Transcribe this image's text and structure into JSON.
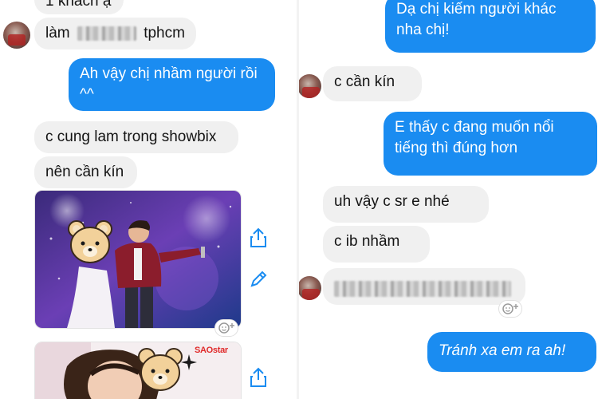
{
  "left": {
    "messages": [
      {
        "text": "1 khách ạ"
      },
      {
        "prefix": "làm",
        "suffix": "tphcm"
      },
      {
        "text_line1": "Ah vậy chị nhầm người rồi",
        "text_line2": "^^"
      },
      {
        "text": "c cung lam trong showbix"
      },
      {
        "text": "nên cần kín"
      }
    ],
    "watermark": "SAOstar"
  },
  "right": {
    "messages": [
      {
        "text_line1": "Dạ chị kiếm người khác",
        "text_line2": "nha chị!"
      },
      {
        "text": "c cần kín"
      },
      {
        "text_line1": "E thấy c đang muốn nổi",
        "text_line2": "tiếng thì đúng hơn"
      },
      {
        "text": "uh vậy c sr e nhé"
      },
      {
        "text": "c ib nhầm"
      },
      {
        "text": "Tránh xa em ra ah!"
      }
    ]
  },
  "colors": {
    "outgoing": "#1a8cf1",
    "incoming": "#f0f0f0"
  },
  "icons": [
    "share-icon",
    "edit-icon",
    "add-reaction-icon",
    "bear-sticker"
  ]
}
